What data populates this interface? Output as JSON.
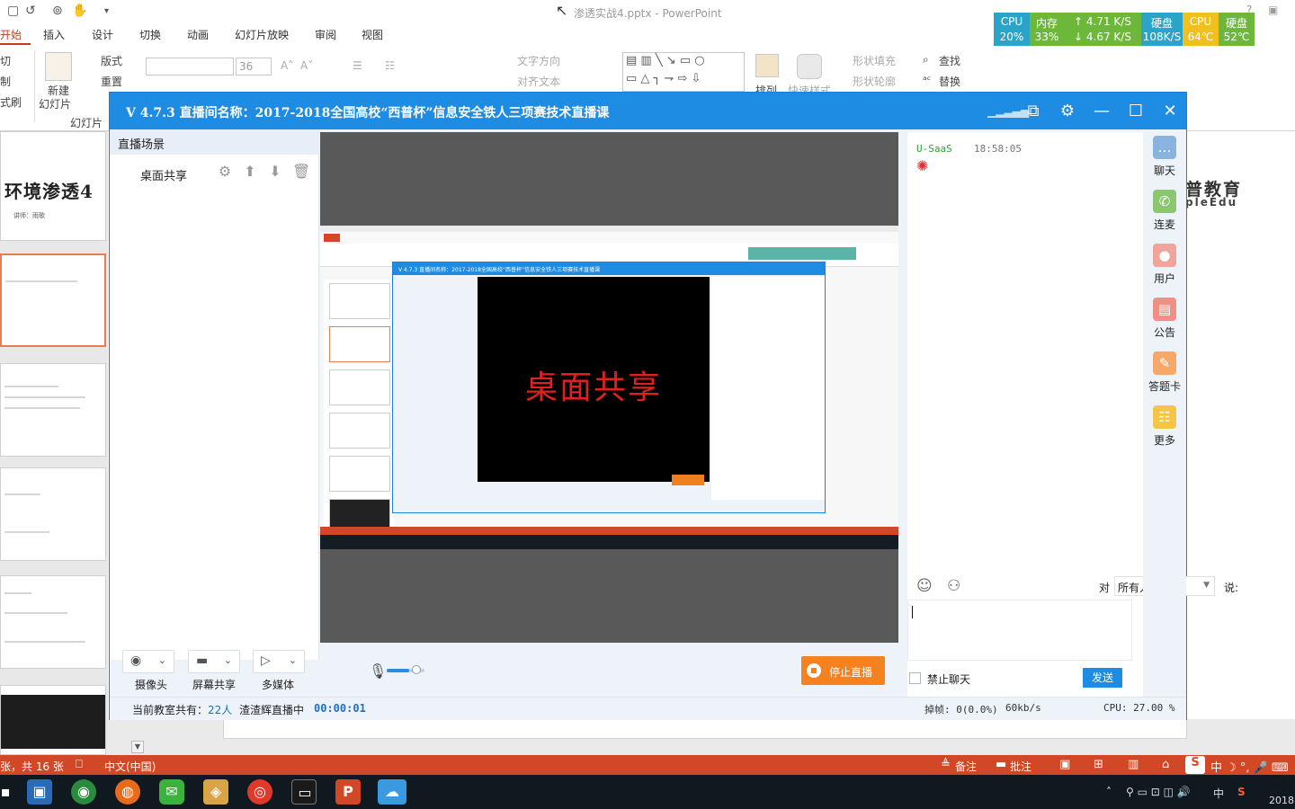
{
  "powerpoint": {
    "title": "渗透实战4.pptx - PowerPoint",
    "tabs": [
      "开始",
      "插入",
      "设计",
      "切换",
      "动画",
      "幻灯片放映",
      "审阅",
      "视图"
    ],
    "ribbon": {
      "new_slide": "新建",
      "new_slide_2": "幻灯片",
      "layout": "版式",
      "reset": "重置",
      "cut": "切",
      "copy": "制",
      "format": "式刷",
      "group_slides": "幻灯片",
      "font_size": "36",
      "text_direction": "文字方向",
      "align_text": "对齐文本",
      "arrange": "排列",
      "quick_styles": "快速样式",
      "shape_fill": "形状填充",
      "shape_outline": "形状轮廓",
      "find": "查找",
      "replace": "替换"
    },
    "thumb1_title": "环境渗透4",
    "thumb1_sub": "讲师：雨歌",
    "brand_line1": "普教育",
    "brand_line2": "pleEdu",
    "status": {
      "slide_count": "张，共 16 张",
      "language": "中文(中国)",
      "notes": "备注",
      "comments": "批注"
    }
  },
  "monitor": {
    "cells": [
      {
        "l1": "CPU",
        "l2": "20%",
        "color": "#2aa4c8"
      },
      {
        "l1": "内存",
        "l2": "33%",
        "color": "#6db83a"
      },
      {
        "l1": "↑ 4.71 K/S",
        "l2": "↓ 4.67 K/S",
        "color": "#6db83a"
      },
      {
        "l1": "硬盘",
        "l2": "108K/S",
        "color": "#2aa4c8"
      },
      {
        "l1": "CPU",
        "l2": "64℃",
        "color": "#f0c020"
      },
      {
        "l1": "硬盘",
        "l2": "52℃",
        "color": "#6db83a"
      }
    ]
  },
  "live": {
    "title": "V 4.7.3 直播间名称：2017-2018全国高校“西普杯”信息安全铁人三项赛技术直播课",
    "scene_header": "直播场景",
    "scene_item": "桌面共享",
    "nested_title": "V 4.7.3 直播间名称：2017-2018全国高校“西普杯”信息安全铁人三项赛技术直播课",
    "nested_video_text": "桌面共享",
    "controls": [
      "摄像头",
      "屏幕共享",
      "多媒体"
    ],
    "stop_label": "停止直播",
    "mic_level": 0.6,
    "bottom": {
      "classroom_prefix": "当前教室共有：",
      "classroom_count": "22人",
      "status_text": "渣渣辉直播中",
      "timer": "00:00:01",
      "dropped": "掉帧: 0(0.0%)",
      "bitrate": "60kb/s",
      "cpu": "CPU: 27.00 %"
    },
    "chat": {
      "user": "U-SaaS",
      "time": "18:58:05",
      "to_label": "对",
      "target": "所有人",
      "say_label": "说:",
      "mute_label": "禁止聊天",
      "send_label": "发送"
    },
    "side_nav": [
      {
        "label": "聊天",
        "icon": "chat-icon",
        "color": "#8ab4e0"
      },
      {
        "label": "连麦",
        "icon": "phone-icon",
        "color": "#8cc770"
      },
      {
        "label": "用户",
        "icon": "user-icon",
        "color": "#f0a49a"
      },
      {
        "label": "公告",
        "icon": "announcement-icon",
        "color": "#f08f85"
      },
      {
        "label": "答题卡",
        "icon": "answer-card-icon",
        "color": "#f5a868"
      },
      {
        "label": "更多",
        "icon": "more-icon",
        "color": "#f5c548"
      }
    ]
  },
  "taskbar": {
    "tray_ime": "中",
    "clock_year": "2018"
  }
}
